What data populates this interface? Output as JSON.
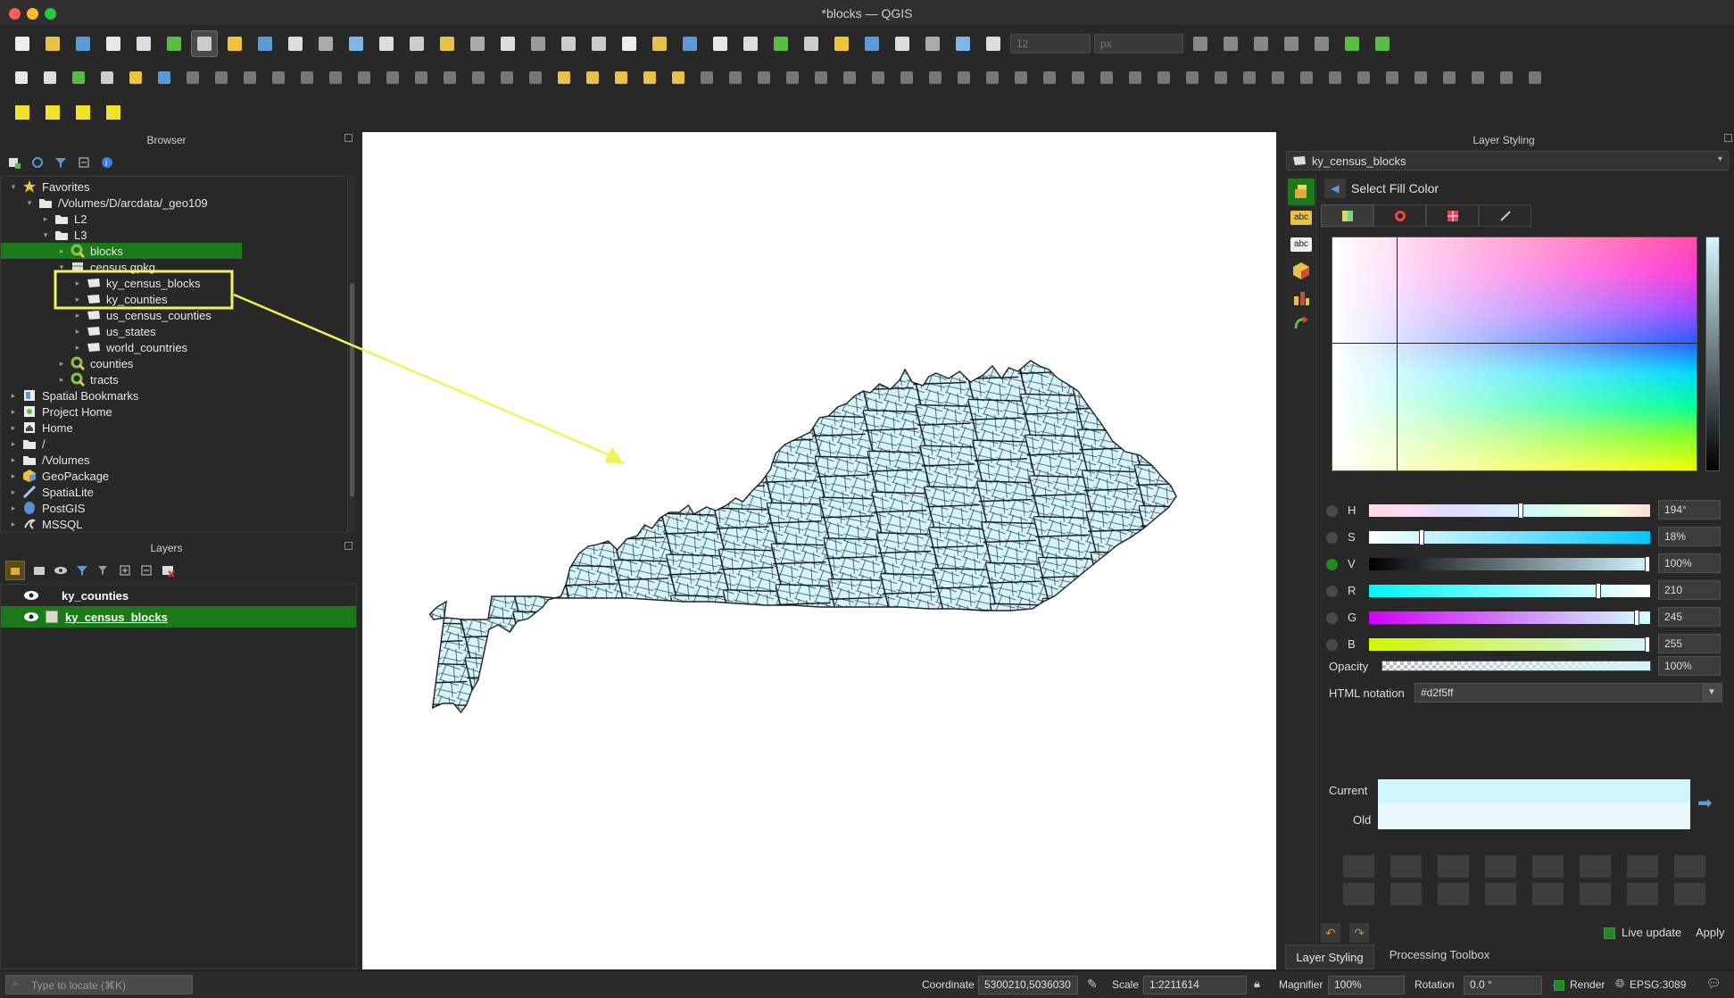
{
  "window": {
    "title": "*blocks — QGIS"
  },
  "browser": {
    "title": "Browser",
    "items": [
      {
        "label": "Favorites"
      },
      {
        "label": "/Volumes/D/arcdata/_geo109"
      },
      {
        "label": "L2"
      },
      {
        "label": "L3"
      },
      {
        "label": "blocks"
      },
      {
        "label": "census.gpkg"
      },
      {
        "label": "ky_census_blocks"
      },
      {
        "label": "ky_counties"
      },
      {
        "label": "us_census_counties"
      },
      {
        "label": "us_states"
      },
      {
        "label": "world_countries"
      },
      {
        "label": "counties"
      },
      {
        "label": "tracts"
      },
      {
        "label": "Spatial Bookmarks"
      },
      {
        "label": "Project Home"
      },
      {
        "label": "Home"
      },
      {
        "label": "/"
      },
      {
        "label": "/Volumes"
      },
      {
        "label": "GeoPackage"
      },
      {
        "label": "SpatiaLite"
      },
      {
        "label": "PostGIS"
      },
      {
        "label": "MSSQL"
      }
    ]
  },
  "layers": {
    "title": "Layers",
    "items": [
      {
        "label": "ky_counties"
      },
      {
        "label": "ky_census_blocks"
      }
    ]
  },
  "toolbar": {
    "snap_tolerance": "12",
    "snap_unit": "px"
  },
  "styling": {
    "title": "Layer Styling",
    "layer_name": "ky_census_blocks",
    "subheader": "Select Fill Color",
    "channels": [
      {
        "label": "H",
        "value": "194°"
      },
      {
        "label": "S",
        "value": "18%"
      },
      {
        "label": "V",
        "value": "100%"
      },
      {
        "label": "R",
        "value": "210"
      },
      {
        "label": "G",
        "value": "245"
      },
      {
        "label": "B",
        "value": "255"
      }
    ],
    "opacity_label": "Opacity",
    "opacity_value": "100%",
    "html_label": "HTML notation",
    "html_value": "#d2f5ff",
    "current_label": "Current",
    "old_label": "Old",
    "live_update": "Live update",
    "apply": "Apply",
    "tabs": [
      "Layer Styling",
      "Processing Toolbox"
    ]
  },
  "status": {
    "locate_placeholder": "Type to locate (⌘K)",
    "coordinate_label": "Coordinate",
    "coordinate_value": "5300210,5036030",
    "scale_label": "Scale",
    "scale_value": "1:2211614",
    "magnifier_label": "Magnifier",
    "magnifier_value": "100%",
    "rotation_label": "Rotation",
    "rotation_value": "0.0 °",
    "render_label": "Render",
    "crs": "EPSG:3089"
  },
  "colors": {
    "fill": "#d2f5ff",
    "highlight": "#1a7a1a",
    "annotation": "#f2f25a"
  }
}
